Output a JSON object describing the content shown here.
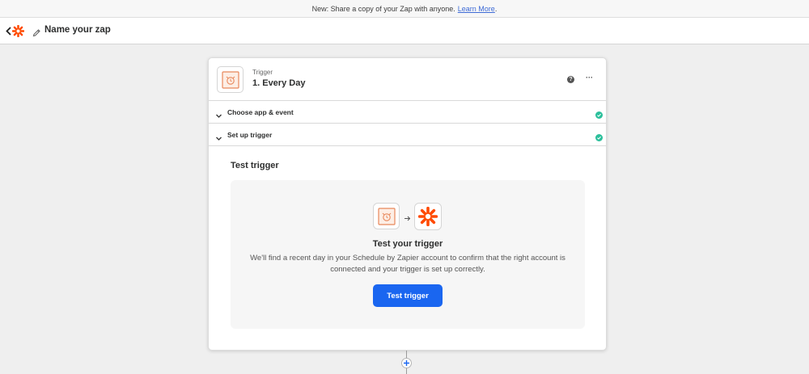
{
  "banner": {
    "text": "New: Share a copy of your Zap with anyone.",
    "link": "Learn More",
    "period": "."
  },
  "header": {
    "zap_name": "Name your zap"
  },
  "step": {
    "label": "Trigger",
    "title": "1. Every Day",
    "help": "?",
    "more": "···"
  },
  "sections": [
    {
      "label": "Choose app & event",
      "complete": true
    },
    {
      "label": "Set up trigger",
      "complete": true
    }
  ],
  "test": {
    "section_title": "Test trigger",
    "heading": "Test your trigger",
    "description": "We'll find a recent day in your Schedule by Zapier account to confirm that the right account is connected and your trigger is set up correctly.",
    "button": "Test trigger"
  },
  "colors": {
    "accent_blue": "#1a66f0",
    "zapier_orange": "#ff4a00",
    "schedule_orange": "#e8875a",
    "success_teal": "#2bbf9b"
  },
  "icons": {
    "back": "chevron-left-icon",
    "logo": "zapier-logo-icon",
    "edit": "pencil-icon",
    "app": "alarm-clock-icon",
    "help": "help-icon",
    "more": "more-horizontal-icon",
    "chevron": "chevron-down-icon",
    "check": "check-circle-icon",
    "arrow": "arrow-right-icon",
    "add": "plus-icon"
  }
}
